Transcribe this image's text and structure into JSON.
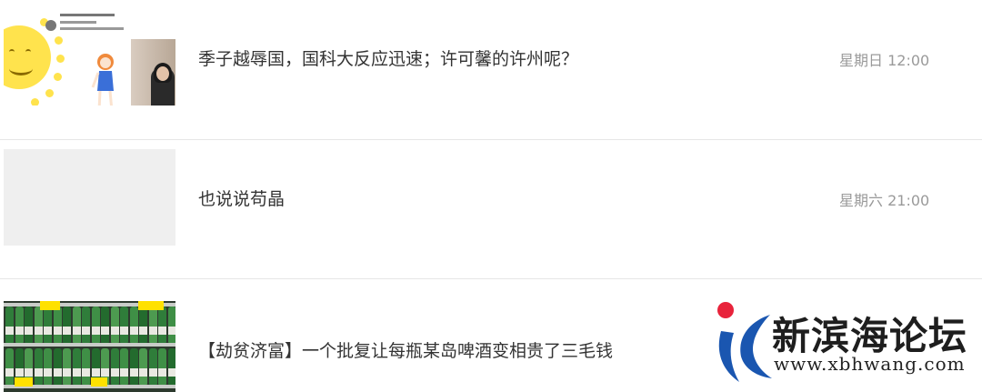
{
  "articles": [
    {
      "title": "季子越辱国，国科大反应迅速；许可馨的许州呢？",
      "time": "星期日 12:00",
      "thumb_icon": "tweet-screenshot-image"
    },
    {
      "title": "也说说苟晶",
      "time": "星期六 21:00",
      "thumb_icon": "placeholder-image"
    },
    {
      "title": "【劫贫济富】一个批复让每瓶某岛啤酒变相贵了三毛钱",
      "time": "",
      "thumb_icon": "beer-shelf-image"
    }
  ],
  "watermark": {
    "name": "新滨海论坛",
    "url": "www.xbhwang.com",
    "dot_color": "#e8233b",
    "logo_color": "#1a56b0"
  }
}
